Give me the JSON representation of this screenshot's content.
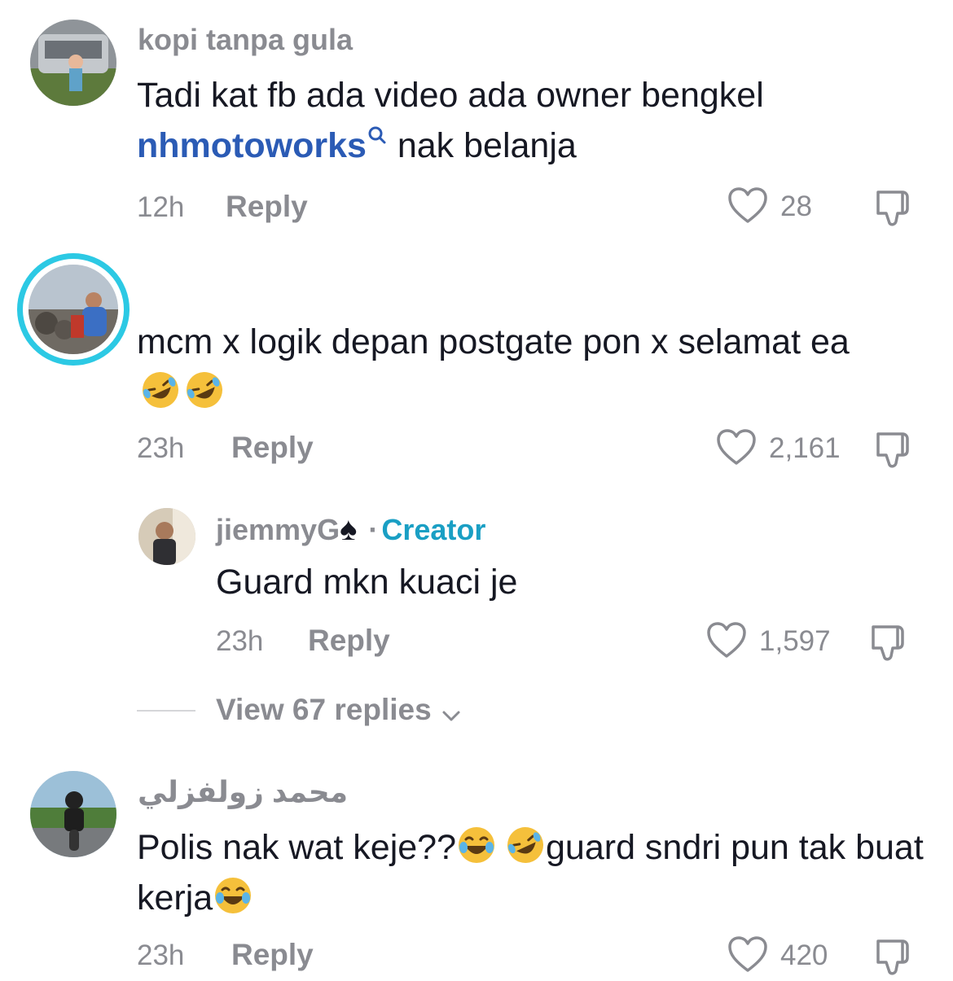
{
  "comments": [
    {
      "username": "kopi tanpa gula",
      "text_before": "Tadi kat fb ada video ada owner bengkel",
      "mention": "nhmotoworks",
      "text_after": " nak belanja",
      "time": "12h",
      "reply_label": "Reply",
      "likes": "28"
    },
    {
      "username": "",
      "text": "mcm x logik depan postgate pon x selamat ea",
      "emojis": [
        "rolling-on-floor-laughing",
        "rolling-on-floor-laughing"
      ],
      "time": "23h",
      "reply_label": "Reply",
      "likes": "2,161"
    },
    {
      "username": "jiemmyG",
      "username_suffix": "♠",
      "separator": "·",
      "creator_label": "Creator",
      "text": "Guard mkn kuaci je",
      "time": "23h",
      "reply_label": "Reply",
      "likes": "1,597"
    },
    {
      "username": "محمد زولفزلي",
      "text_part1": "Polis nak wat keje??",
      "text_part2": "guard sndri pun tak buat kerja",
      "emojis": [
        "face-with-tears-of-joy",
        "rolling-on-floor-laughing",
        "face-with-tears-of-joy"
      ],
      "time": "23h",
      "reply_label": "Reply",
      "likes": "420"
    }
  ],
  "view_replies": "View 67 replies",
  "icons": {
    "like": "heart-outline-icon",
    "dislike": "thumbs-down-icon",
    "chevron": "chevron-down-icon",
    "mention_search": "search-icon"
  },
  "colors": {
    "accent_creator": "#1a9fc4",
    "mention": "#2b5bb5",
    "avatar_ring": "#2cc9e4",
    "muted": "#8a8b91"
  }
}
